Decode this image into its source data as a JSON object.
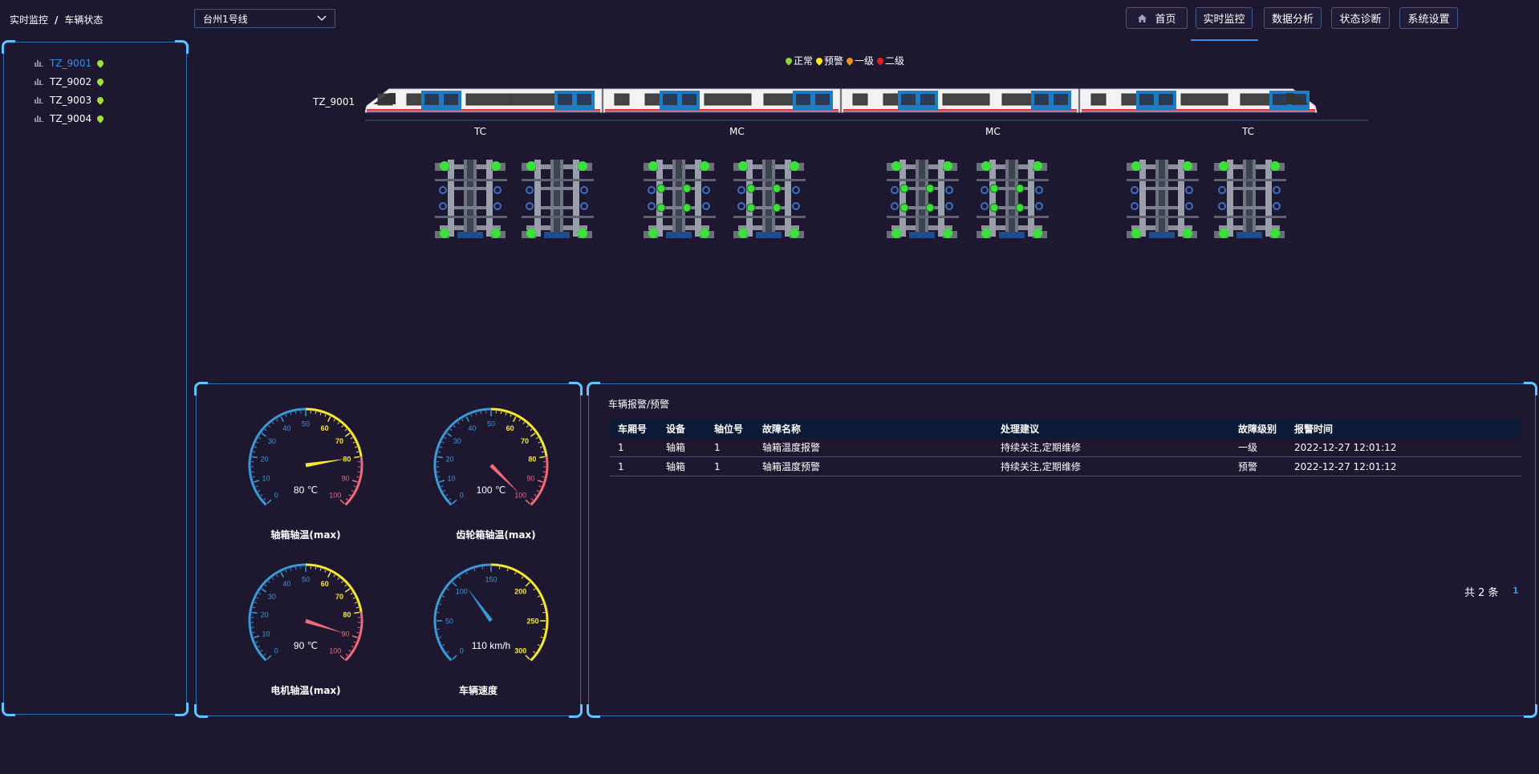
{
  "breadcrumb": {
    "root": "实时监控",
    "separator": "/",
    "current": "车辆状态"
  },
  "line_select": {
    "value": "台州1号线"
  },
  "nav": {
    "home": "首页",
    "realtime": "实时监控",
    "analysis": "数据分析",
    "diagnosis": "状态诊断",
    "settings": "系统设置"
  },
  "tree": {
    "items": [
      {
        "label": "TZ_9001",
        "status_color": "#9be33a",
        "selected": true
      },
      {
        "label": "TZ_9002",
        "status_color": "#9be33a",
        "selected": false
      },
      {
        "label": "TZ_9003",
        "status_color": "#9be33a",
        "selected": false
      },
      {
        "label": "TZ_9004",
        "status_color": "#9be33a",
        "selected": false
      }
    ]
  },
  "legend": {
    "normal": {
      "label": "正常",
      "color": "#8ed33a"
    },
    "warning": {
      "label": "预警",
      "color": "#ffe81a"
    },
    "level1": {
      "label": "一级",
      "color": "#f09020"
    },
    "level2": {
      "label": "二级",
      "color": "#e02020"
    }
  },
  "train": {
    "id": "TZ_9001",
    "cars": [
      "TC",
      "MC",
      "MC",
      "TC"
    ]
  },
  "gauges": [
    {
      "title": "轴箱轴温(max)",
      "value": 80,
      "unit": "℃",
      "readout": "80 ℃",
      "ticks": [
        "0",
        "10",
        "20",
        "30",
        "40",
        "50",
        "60",
        "70",
        "80",
        "90",
        "100"
      ]
    },
    {
      "title": "齿轮箱轴温(max)",
      "value": 100,
      "unit": "℃",
      "readout": "100 ℃",
      "ticks": [
        "0",
        "10",
        "20",
        "30",
        "40",
        "50",
        "60",
        "70",
        "80",
        "90",
        "100"
      ]
    },
    {
      "title": "电机轴温(max)",
      "value": 90,
      "unit": "℃",
      "readout": "90 ℃",
      "ticks": [
        "0",
        "10",
        "20",
        "30",
        "40",
        "50",
        "60",
        "70",
        "80",
        "90",
        "100"
      ]
    },
    {
      "title": "车辆速度",
      "value": 110,
      "unit": "km/h",
      "readout": "110 km/h",
      "ticks": [
        "0",
        "50",
        "100",
        "150",
        "200",
        "250",
        "300"
      ]
    }
  ],
  "alarm_panel": {
    "title": "车辆报警/预警",
    "columns": [
      "车厢号",
      "设备",
      "轴位号",
      "故障名称",
      "处理建议",
      "故障级别",
      "报警时间"
    ],
    "rows": [
      [
        "1",
        "轴箱",
        "1",
        "轴箱温度报警",
        "持续关注,定期维修",
        "一级",
        "2022-12-27 12:01:12"
      ],
      [
        "1",
        "轴箱",
        "1",
        "轴箱温度预警",
        "持续关注,定期维修",
        "预警",
        "2022-12-27 12:01:12"
      ]
    ],
    "total": "共 2 条",
    "page": "1"
  },
  "colors": {
    "background": "#1d1830",
    "panel_border": "#2c6fae",
    "accent": "#3a8fe0",
    "gauge_blue": "#3a9ad8",
    "gauge_yellow": "#f6e832",
    "gauge_red": "#f06b7a"
  }
}
